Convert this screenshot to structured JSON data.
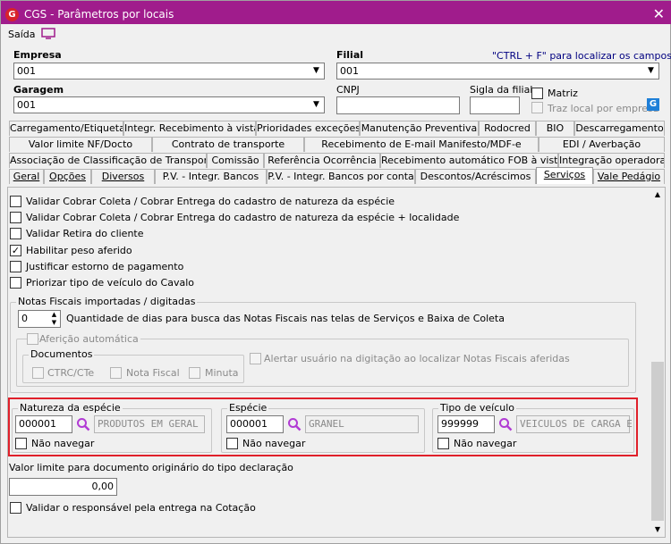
{
  "window": {
    "title": "CGS - Parâmetros por locais"
  },
  "menu": {
    "saida": "Saída"
  },
  "header": {
    "empresa_label": "Empresa",
    "empresa_value": "001",
    "filial_label": "Filial",
    "filial_value": "001",
    "hint": "\"CTRL + F\" para localizar os campos",
    "garagem_label": "Garagem",
    "garagem_value": "001",
    "cnpj_label": "CNPJ",
    "cnpj_value": "",
    "sigla_label": "Sigla da filial",
    "sigla_value": "",
    "matriz_label": "Matriz",
    "traz_local_label": "Traz local por empresa"
  },
  "tabs_row1": [
    "Carregamento/Etiquetas",
    "Integr. Recebimento à vista",
    "Prioridades exceções",
    "Manutenção Preventiva",
    "Rodocred",
    "BIO",
    "Descarregamento"
  ],
  "tabs_row2": [
    "Valor limite NF/Docto",
    "Contrato de transporte",
    "Recebimento de E-mail Manifesto/MDF-e",
    "EDI / Averbação"
  ],
  "tabs_row3": [
    "Associação de Classificação de Transporte",
    "Comissão",
    "Referência Ocorrência",
    "Recebimento automático FOB à vista",
    "Integração operadoras"
  ],
  "tabs_row4": [
    "Geral",
    "Opções",
    "Diversos",
    "P.V. - Integr. Bancos",
    "P.V. - Integr. Bancos por conta",
    "Descontos/Acréscimos",
    "Serviços",
    "Vale Pedágio"
  ],
  "options": {
    "opt1": "Validar Cobrar Coleta / Cobrar Entrega do cadastro de natureza da espécie",
    "opt2": "Validar Cobrar Coleta / Cobrar Entrega do cadastro de natureza da espécie + localidade",
    "opt3": "Validar Retira do cliente",
    "opt4": "Habilitar peso aferido",
    "opt5": "Justificar estorno de pagamento",
    "opt6": "Priorizar tipo de veículo do Cavalo",
    "opt4_checked": "✓"
  },
  "nf_group": {
    "title": "Notas Fiscais importadas / digitadas",
    "days_value": "0",
    "days_label": "Quantidade de dias para busca das Notas Fiscais nas telas de Serviços e Baixa de Coleta",
    "afericao_label": "Aferição automática",
    "documentos_label": "Documentos",
    "ctrc_label": "CTRC/CTe",
    "nf_label": "Nota Fiscal",
    "minuta_label": "Minuta",
    "alertar_label": "Alertar usuário na digitação ao localizar Notas Fiscais aferidas"
  },
  "natureza": {
    "title": "Natureza da espécie",
    "code": "000001",
    "desc": "PRODUTOS EM GERAL",
    "nao_navegar": "Não navegar"
  },
  "especie": {
    "title": "Espécie",
    "code": "000001",
    "desc": "GRANEL",
    "nao_navegar": "Não navegar"
  },
  "tipo_veiculo": {
    "title": "Tipo de veículo",
    "code": "999999",
    "desc": "VEICULOS DE CARGA E",
    "nao_navegar": "Não navegar"
  },
  "valor_limite": {
    "label": "Valor limite para documento originário do tipo declaração",
    "value": "0,00"
  },
  "validar_responsavel": "Validar o responsável pela entrega na Cotação",
  "colors": {
    "title_bar": "#a01c8c",
    "highlight": "#e0202a",
    "search_icon": "#b13bd4"
  }
}
